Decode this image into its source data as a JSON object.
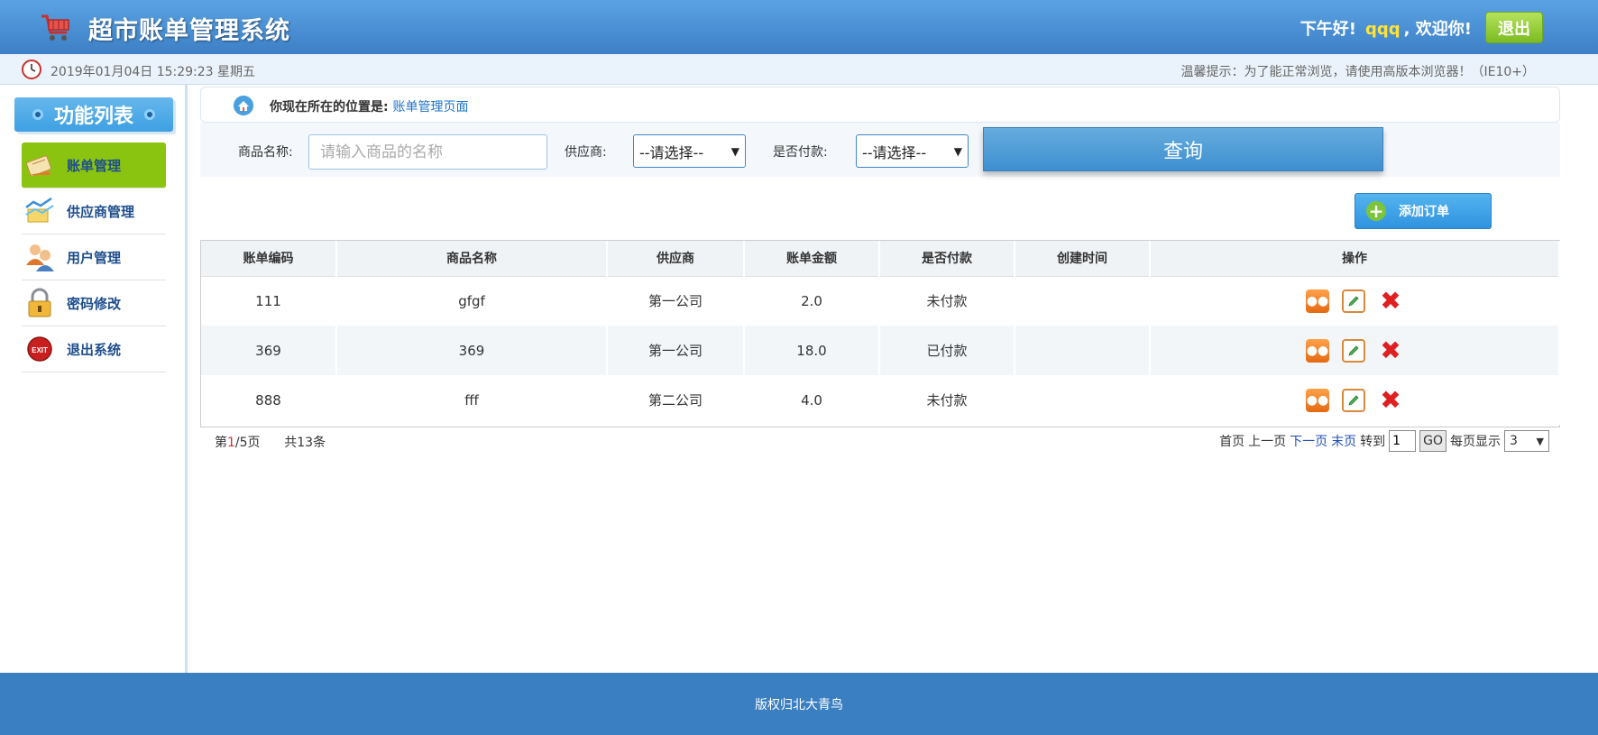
{
  "header": {
    "title": "超市账单管理系统",
    "greeting": "下午好!",
    "username": "qqq",
    "welcome": ", 欢迎你!",
    "logout_label": "退出"
  },
  "timebar": {
    "datetime": "2019年01月04日 15:29:23 星期五",
    "tip": "温馨提示：为了能正常浏览，请使用高版本浏览器！（IE10+）"
  },
  "sidebar": {
    "title": "功能列表",
    "items": [
      {
        "label": "账单管理",
        "icon": "bill-icon",
        "active": true
      },
      {
        "label": "供应商管理",
        "icon": "supplier-icon",
        "active": false
      },
      {
        "label": "用户管理",
        "icon": "users-icon",
        "active": false
      },
      {
        "label": "密码修改",
        "icon": "lock-icon",
        "active": false
      },
      {
        "label": "退出系统",
        "icon": "exit-icon",
        "active": false
      }
    ]
  },
  "location": {
    "prefix": "你现在所在的位置是:",
    "current": "账单管理页面"
  },
  "search": {
    "product_label": "商品名称:",
    "product_placeholder": "请输入商品的名称",
    "supplier_label": "供应商:",
    "supplier_value": "--请选择--",
    "paid_label": "是否付款:",
    "paid_value": "--请选择--",
    "query_label": "查询"
  },
  "add_button_label": "添加订单",
  "table": {
    "headers": [
      "账单编码",
      "商品名称",
      "供应商",
      "账单金额",
      "是否付款",
      "创建时间",
      "操作"
    ],
    "rows": [
      {
        "code": "111",
        "name": "gfgf",
        "supplier": "第一公司",
        "amount": "2.0",
        "paid": "未付款",
        "created": ""
      },
      {
        "code": "369",
        "name": "369",
        "supplier": "第一公司",
        "amount": "18.0",
        "paid": "已付款",
        "created": ""
      },
      {
        "code": "888",
        "name": "fff",
        "supplier": "第二公司",
        "amount": "4.0",
        "paid": "未付款",
        "created": ""
      }
    ]
  },
  "pager": {
    "page_prefix": "第",
    "current_page": "1",
    "page_suffix": "/5页",
    "total": "共13条",
    "first": "首页",
    "prev": "上一页",
    "next": "下一页",
    "last": "末页",
    "goto_label": "转到",
    "goto_value": "1",
    "go_label": "GO",
    "page_size_label": "每页显示",
    "page_size_value": "3"
  },
  "footer": {
    "copyright": "版权归北大青鸟"
  },
  "colors": {
    "header_blue": "#3d7fc6",
    "active_green": "#8bc410",
    "footer_blue": "#3a7fc1",
    "username_yellow": "#ffe437"
  }
}
